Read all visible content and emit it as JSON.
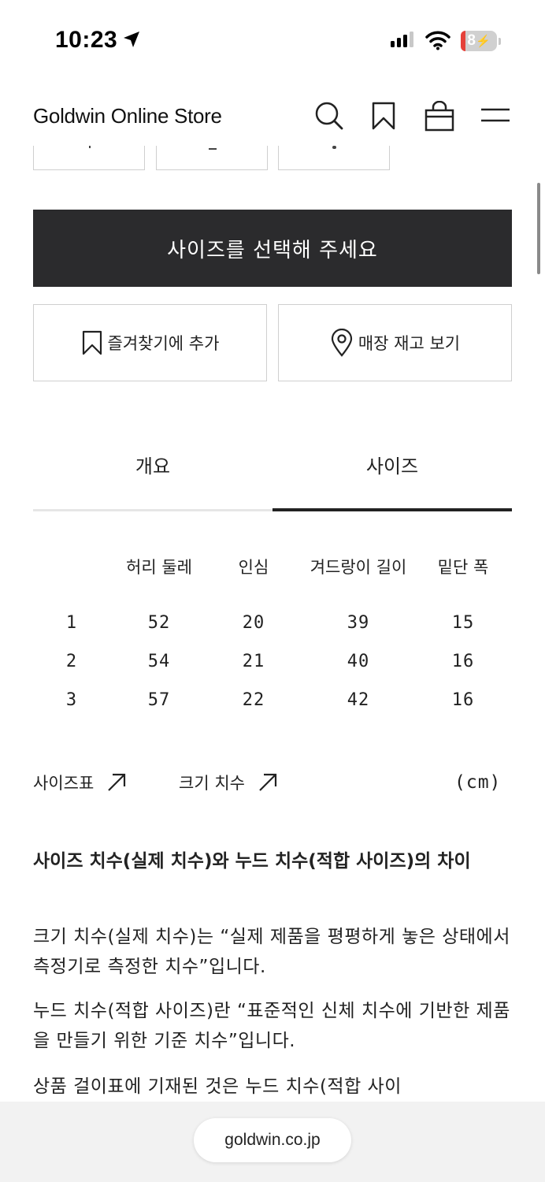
{
  "status_bar": {
    "time": "10:23",
    "battery": "8"
  },
  "header": {
    "title": "Goldwin Online Store",
    "icons": [
      "search-icon",
      "bookmark-icon",
      "cart-icon",
      "menu-icon"
    ]
  },
  "actions": {
    "select_size": "사이즈를 선택해 주세요",
    "add_favorite": "즐겨찾기에 추가",
    "store_stock": "매장 재고 보기"
  },
  "tabs": [
    {
      "label": "개요",
      "active": false
    },
    {
      "label": "사이즈",
      "active": true
    }
  ],
  "size_table": {
    "headers": [
      "",
      "허리 둘레",
      "인심",
      "겨드랑이 길이",
      "밑단 폭"
    ],
    "rows": [
      [
        "1",
        "52",
        "20",
        "39",
        "15"
      ],
      [
        "2",
        "54",
        "21",
        "40",
        "16"
      ],
      [
        "3",
        "57",
        "22",
        "42",
        "16"
      ]
    ]
  },
  "links": {
    "size_chart": "사이즈표",
    "measurement": "크기 치수",
    "unit": "(cm)"
  },
  "description": {
    "title": "사이즈 치수(실제 치수)와 누드 치수(적합 사이즈)의 차이",
    "p1": "크기 치수(실제 치수)는 “실제 제품을 평평하게 놓은 상태에서 측정기로 측정한 치수”입니다.",
    "p2": "누드 치수(적합 사이즈)란 “표준적인 신체 치수에 기반한 제품을 만들기 위한 기준 치수”입니다.",
    "p3": "상품 걸이표에 기재된 것은 누드 치수(적합 사이"
  },
  "browser": {
    "url": "goldwin.co.jp"
  },
  "colors": {
    "primary_button": "#2b2b2d",
    "border": "#cfcfcf",
    "tab_active": "#222222"
  }
}
